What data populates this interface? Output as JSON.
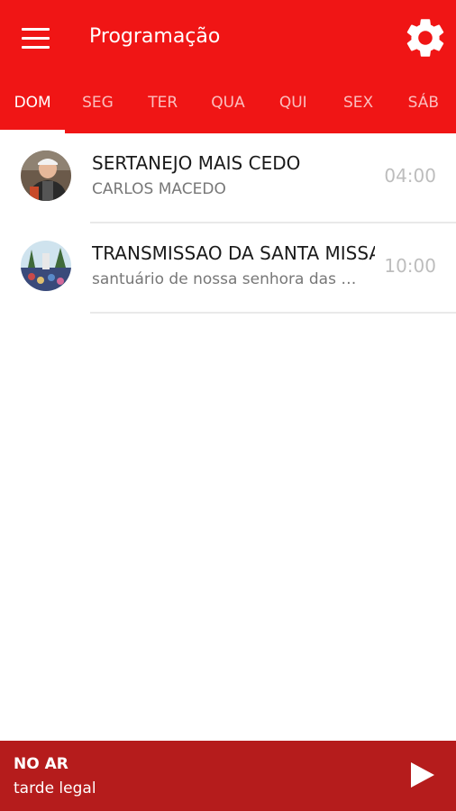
{
  "colors": {
    "primary": "#f01515",
    "player_bg": "#b51c1c",
    "text_primary": "#1a1a1a",
    "text_secondary": "#777777",
    "time_text": "#bdbdbd"
  },
  "header": {
    "title": "Programação",
    "menu_icon": "hamburger-menu-icon",
    "settings_icon": "gear-icon"
  },
  "tabs": [
    {
      "label": "DOM",
      "active": true
    },
    {
      "label": "SEG",
      "active": false
    },
    {
      "label": "TER",
      "active": false
    },
    {
      "label": "QUA",
      "active": false
    },
    {
      "label": "QUI",
      "active": false
    },
    {
      "label": "SEX",
      "active": false
    },
    {
      "label": "SÁB",
      "active": false
    }
  ],
  "schedule": [
    {
      "title": "SERTANEJO MAIS CEDO",
      "host": "CARLOS MACEDO",
      "time": "04:00"
    },
    {
      "title": "TRANSMISSAO DA SANTA MISSA",
      "host": "santuário de nossa senhora das …",
      "time": "10:00"
    }
  ],
  "player": {
    "status": "NO AR",
    "now_playing": "tarde legal",
    "play_icon": "play-icon"
  }
}
